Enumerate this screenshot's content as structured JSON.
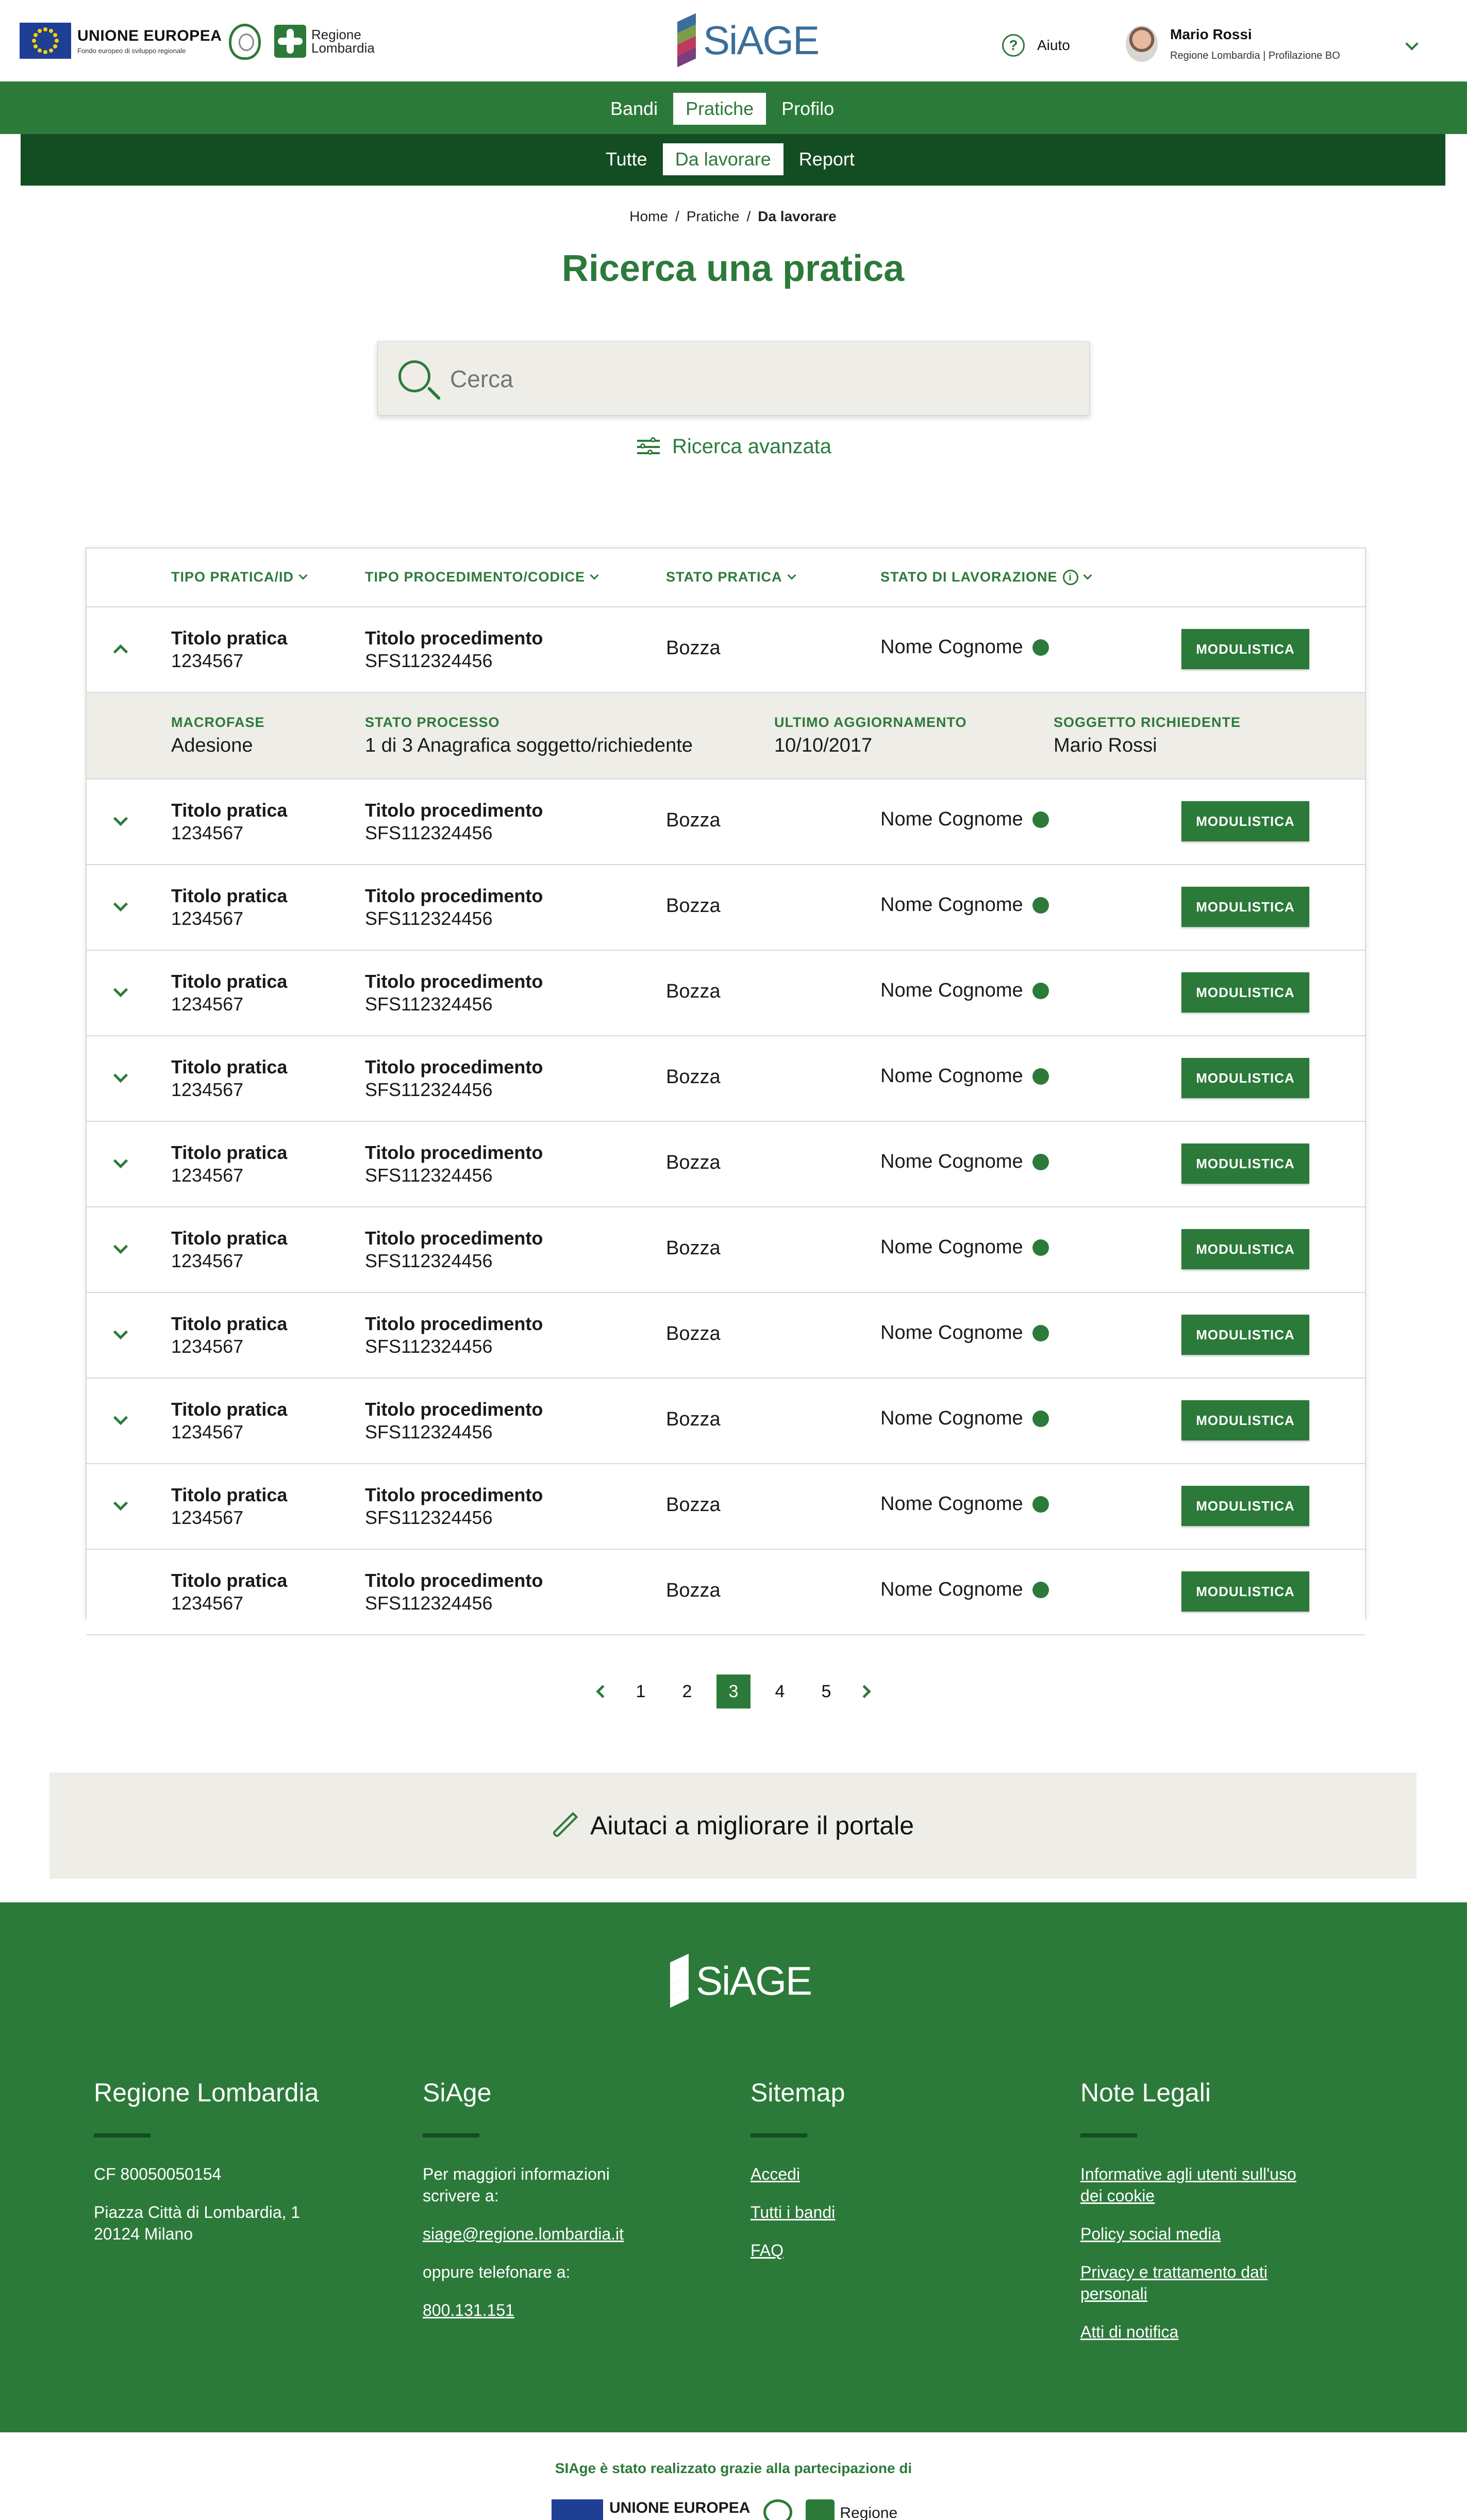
{
  "header": {
    "eu_title": "UNIONE EUROPEA",
    "eu_subtitle": "Fondo europeo di sviluppo regionale",
    "region_logo_text": "Regione Lombardia",
    "brand": "SiAGE",
    "help_label": "Aiuto",
    "user_name": "Mario Rossi",
    "user_role": "Regione Lombardia | Profilazione BO"
  },
  "nav": {
    "primary": [
      {
        "label": "Bandi",
        "active": false
      },
      {
        "label": "Pratiche",
        "active": true
      },
      {
        "label": "Profilo",
        "active": false
      }
    ],
    "secondary": [
      {
        "label": "Tutte",
        "active": false
      },
      {
        "label": "Da lavorare",
        "active": true
      },
      {
        "label": "Report",
        "active": false
      }
    ]
  },
  "breadcrumb": [
    "Home",
    "Pratiche",
    "Da lavorare"
  ],
  "page_title": "Ricerca una pratica",
  "search": {
    "placeholder": "Cerca"
  },
  "advanced_search_label": "Ricerca avanzata",
  "table": {
    "headers": [
      "TIPO PRATICA/ID",
      "TIPO PROCEDIMENTO/CODICE",
      "STATO PRATICA",
      "STATO DI LAVORAZIONE"
    ],
    "button_label": "MODULISTICA",
    "rows": [
      {
        "title": "Titolo pratica",
        "id": "1234567",
        "proc": "Titolo procedimento",
        "code": "SFS112324456",
        "stato": "Bozza",
        "lavorazione": "Nome Cognome",
        "expanded": true,
        "toggle": true
      },
      {
        "title": "Titolo pratica",
        "id": "1234567",
        "proc": "Titolo procedimento",
        "code": "SFS112324456",
        "stato": "Bozza",
        "lavorazione": "Nome Cognome",
        "expanded": false,
        "toggle": true
      },
      {
        "title": "Titolo pratica",
        "id": "1234567",
        "proc": "Titolo procedimento",
        "code": "SFS112324456",
        "stato": "Bozza",
        "lavorazione": "Nome Cognome",
        "expanded": false,
        "toggle": true
      },
      {
        "title": "Titolo pratica",
        "id": "1234567",
        "proc": "Titolo procedimento",
        "code": "SFS112324456",
        "stato": "Bozza",
        "lavorazione": "Nome Cognome",
        "expanded": false,
        "toggle": true
      },
      {
        "title": "Titolo pratica",
        "id": "1234567",
        "proc": "Titolo procedimento",
        "code": "SFS112324456",
        "stato": "Bozza",
        "lavorazione": "Nome Cognome",
        "expanded": false,
        "toggle": true
      },
      {
        "title": "Titolo pratica",
        "id": "1234567",
        "proc": "Titolo procedimento",
        "code": "SFS112324456",
        "stato": "Bozza",
        "lavorazione": "Nome Cognome",
        "expanded": false,
        "toggle": true
      },
      {
        "title": "Titolo pratica",
        "id": "1234567",
        "proc": "Titolo procedimento",
        "code": "SFS112324456",
        "stato": "Bozza",
        "lavorazione": "Nome Cognome",
        "expanded": false,
        "toggle": true
      },
      {
        "title": "Titolo pratica",
        "id": "1234567",
        "proc": "Titolo procedimento",
        "code": "SFS112324456",
        "stato": "Bozza",
        "lavorazione": "Nome Cognome",
        "expanded": false,
        "toggle": true
      },
      {
        "title": "Titolo pratica",
        "id": "1234567",
        "proc": "Titolo procedimento",
        "code": "SFS112324456",
        "stato": "Bozza",
        "lavorazione": "Nome Cognome",
        "expanded": false,
        "toggle": true
      },
      {
        "title": "Titolo pratica",
        "id": "1234567",
        "proc": "Titolo procedimento",
        "code": "SFS112324456",
        "stato": "Bozza",
        "lavorazione": "Nome Cognome",
        "expanded": false,
        "toggle": true
      },
      {
        "title": "Titolo pratica",
        "id": "1234567",
        "proc": "Titolo procedimento",
        "code": "SFS112324456",
        "stato": "Bozza",
        "lavorazione": "Nome Cognome",
        "expanded": false,
        "toggle": false
      }
    ],
    "detail": [
      {
        "label": "MACROFASE",
        "value": "Adesione"
      },
      {
        "label": "STATO PROCESSO",
        "value": "1 di 3 Anagrafica soggetto/richiedente"
      },
      {
        "label": "ULTIMO AGGIORNAMENTO",
        "value": "10/10/2017"
      },
      {
        "label": "SOGGETTO RICHIEDENTE",
        "value": "Mario Rossi"
      }
    ]
  },
  "pagination": {
    "pages": [
      "1",
      "2",
      "3",
      "4",
      "5"
    ],
    "current": "3"
  },
  "improve_label": "Aiutaci a migliorare il portale",
  "footer": {
    "brand": "SiAGE",
    "columns": {
      "regione": {
        "title": "Regione Lombardia",
        "lines": [
          "CF 80050050154",
          "Piazza Città di Lombardia, 1 20124 Milano"
        ]
      },
      "siage": {
        "title": "SiAge",
        "info": "Per maggiori informazioni scrivere a:",
        "email": "siage@regione.lombardia.it",
        "phone_label": "oppure telefonare a:",
        "phone": "800.131.151"
      },
      "sitemap": {
        "title": "Sitemap",
        "links": [
          "Accedi",
          "Tutti i bandi",
          "FAQ"
        ]
      },
      "legal": {
        "title": "Note Legali",
        "links": [
          "Informative agli utenti sull'uso dei cookie",
          "Policy social media",
          "Privacy e trattamento dati personali",
          "Atti di notifica"
        ]
      }
    },
    "credit": "SIAge è stato realizzato grazie alla partecipazione di",
    "credit_eu": "UNIONE EUROPEA",
    "credit_region": "Regione"
  },
  "colors": {
    "primary": "#2c7a3a",
    "primary_dark": "#134d22",
    "panel": "#eeede8",
    "brand_blue": "#3a6f9a"
  }
}
